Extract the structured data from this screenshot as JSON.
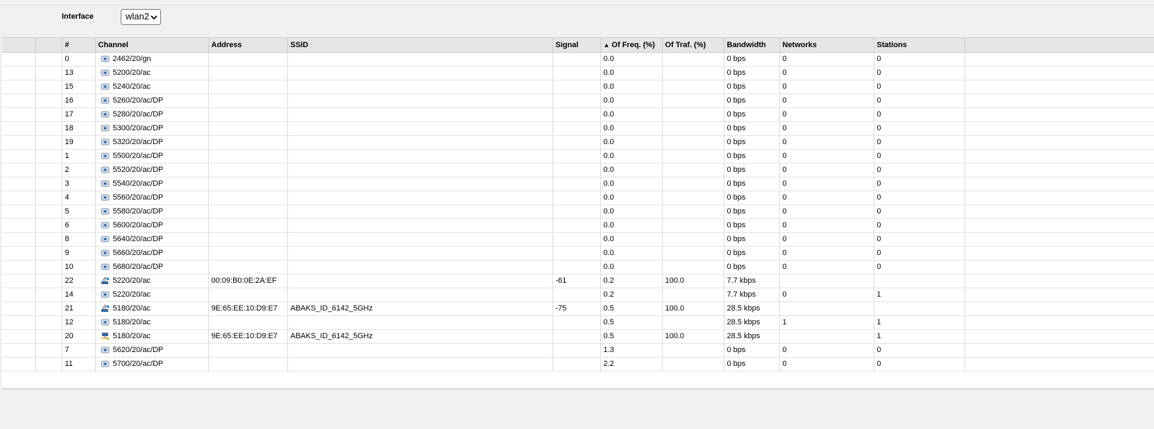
{
  "interface": {
    "label": "Interface",
    "selected": "wlan2"
  },
  "columns": {
    "num": "#",
    "channel": "Channel",
    "address": "Address",
    "ssid": "SSID",
    "signal": "Signal",
    "sort_arrow": "▲",
    "of_freq": "Of Freq. (%)",
    "of_traf": "Of Traf. (%)",
    "bandwidth": "Bandwidth",
    "networks": "Networks",
    "stations": "Stations"
  },
  "rows": [
    {
      "num": "0",
      "icon": "channel-icon",
      "channel": "2462/20/gn",
      "address": "",
      "ssid": "",
      "signal": "",
      "freq": "0.0",
      "traf": "",
      "bandwidth": "0 bps",
      "networks": "0",
      "stations": "0"
    },
    {
      "num": "13",
      "icon": "channel-icon",
      "channel": "5200/20/ac",
      "address": "",
      "ssid": "",
      "signal": "",
      "freq": "0.0",
      "traf": "",
      "bandwidth": "0 bps",
      "networks": "0",
      "stations": "0"
    },
    {
      "num": "15",
      "icon": "channel-icon",
      "channel": "5240/20/ac",
      "address": "",
      "ssid": "",
      "signal": "",
      "freq": "0.0",
      "traf": "",
      "bandwidth": "0 bps",
      "networks": "0",
      "stations": "0"
    },
    {
      "num": "16",
      "icon": "channel-icon",
      "channel": "5260/20/ac/DP",
      "address": "",
      "ssid": "",
      "signal": "",
      "freq": "0.0",
      "traf": "",
      "bandwidth": "0 bps",
      "networks": "0",
      "stations": "0"
    },
    {
      "num": "17",
      "icon": "channel-icon",
      "channel": "5280/20/ac/DP",
      "address": "",
      "ssid": "",
      "signal": "",
      "freq": "0.0",
      "traf": "",
      "bandwidth": "0 bps",
      "networks": "0",
      "stations": "0"
    },
    {
      "num": "18",
      "icon": "channel-icon",
      "channel": "5300/20/ac/DP",
      "address": "",
      "ssid": "",
      "signal": "",
      "freq": "0.0",
      "traf": "",
      "bandwidth": "0 bps",
      "networks": "0",
      "stations": "0"
    },
    {
      "num": "19",
      "icon": "channel-icon",
      "channel": "5320/20/ac/DP",
      "address": "",
      "ssid": "",
      "signal": "",
      "freq": "0.0",
      "traf": "",
      "bandwidth": "0 bps",
      "networks": "0",
      "stations": "0"
    },
    {
      "num": "1",
      "icon": "channel-icon",
      "channel": "5500/20/ac/DP",
      "address": "",
      "ssid": "",
      "signal": "",
      "freq": "0.0",
      "traf": "",
      "bandwidth": "0 bps",
      "networks": "0",
      "stations": "0"
    },
    {
      "num": "2",
      "icon": "channel-icon",
      "channel": "5520/20/ac/DP",
      "address": "",
      "ssid": "",
      "signal": "",
      "freq": "0.0",
      "traf": "",
      "bandwidth": "0 bps",
      "networks": "0",
      "stations": "0"
    },
    {
      "num": "3",
      "icon": "channel-icon",
      "channel": "5540/20/ac/DP",
      "address": "",
      "ssid": "",
      "signal": "",
      "freq": "0.0",
      "traf": "",
      "bandwidth": "0 bps",
      "networks": "0",
      "stations": "0"
    },
    {
      "num": "4",
      "icon": "channel-icon",
      "channel": "5560/20/ac/DP",
      "address": "",
      "ssid": "",
      "signal": "",
      "freq": "0.0",
      "traf": "",
      "bandwidth": "0 bps",
      "networks": "0",
      "stations": "0"
    },
    {
      "num": "5",
      "icon": "channel-icon",
      "channel": "5580/20/ac/DP",
      "address": "",
      "ssid": "",
      "signal": "",
      "freq": "0.0",
      "traf": "",
      "bandwidth": "0 bps",
      "networks": "0",
      "stations": "0"
    },
    {
      "num": "6",
      "icon": "channel-icon",
      "channel": "5600/20/ac/DP",
      "address": "",
      "ssid": "",
      "signal": "",
      "freq": "0.0",
      "traf": "",
      "bandwidth": "0 bps",
      "networks": "0",
      "stations": "0"
    },
    {
      "num": "8",
      "icon": "channel-icon",
      "channel": "5640/20/ac/DP",
      "address": "",
      "ssid": "",
      "signal": "",
      "freq": "0.0",
      "traf": "",
      "bandwidth": "0 bps",
      "networks": "0",
      "stations": "0"
    },
    {
      "num": "9",
      "icon": "channel-icon",
      "channel": "5660/20/ac/DP",
      "address": "",
      "ssid": "",
      "signal": "",
      "freq": "0.0",
      "traf": "",
      "bandwidth": "0 bps",
      "networks": "0",
      "stations": "0"
    },
    {
      "num": "10",
      "icon": "channel-icon",
      "channel": "5680/20/ac/DP",
      "address": "",
      "ssid": "",
      "signal": "",
      "freq": "0.0",
      "traf": "",
      "bandwidth": "0 bps",
      "networks": "0",
      "stations": "0"
    },
    {
      "num": "22",
      "icon": "access-point-icon",
      "channel": "5220/20/ac",
      "address": "00:09:B0:0E:2A:EF",
      "ssid": "",
      "signal": "-61",
      "freq": "0.2",
      "traf": "100.0",
      "bandwidth": "7.7 kbps",
      "networks": "",
      "stations": ""
    },
    {
      "num": "14",
      "icon": "channel-icon",
      "channel": "5220/20/ac",
      "address": "",
      "ssid": "",
      "signal": "",
      "freq": "0.2",
      "traf": "",
      "bandwidth": "7.7 kbps",
      "networks": "0",
      "stations": "1"
    },
    {
      "num": "21",
      "icon": "access-point-icon",
      "channel": "5180/20/ac",
      "address": "9E:65:EE:10:D9:E7",
      "ssid": "ABAKS_ID_6142_5GHz",
      "signal": "-75",
      "freq": "0.5",
      "traf": "100.0",
      "bandwidth": "28.5 kbps",
      "networks": "",
      "stations": ""
    },
    {
      "num": "12",
      "icon": "channel-icon",
      "channel": "5180/20/ac",
      "address": "",
      "ssid": "",
      "signal": "",
      "freq": "0.5",
      "traf": "",
      "bandwidth": "28.5 kbps",
      "networks": "1",
      "stations": "1"
    },
    {
      "num": "20",
      "icon": "network-icon",
      "channel": "5180/20/ac",
      "address": "9E:65:EE:10:D9:E7",
      "ssid": "ABAKS_ID_6142_5GHz",
      "signal": "",
      "freq": "0.5",
      "traf": "100.0",
      "bandwidth": "28.5 kbps",
      "networks": "",
      "stations": "1"
    },
    {
      "num": "7",
      "icon": "channel-icon",
      "channel": "5620/20/ac/DP",
      "address": "",
      "ssid": "",
      "signal": "",
      "freq": "1.3",
      "traf": "",
      "bandwidth": "0 bps",
      "networks": "0",
      "stations": "0"
    },
    {
      "num": "11",
      "icon": "channel-icon",
      "channel": "5700/20/ac/DP",
      "address": "",
      "ssid": "",
      "signal": "",
      "freq": "2.2",
      "traf": "",
      "bandwidth": "0 bps",
      "networks": "0",
      "stations": "0"
    }
  ]
}
